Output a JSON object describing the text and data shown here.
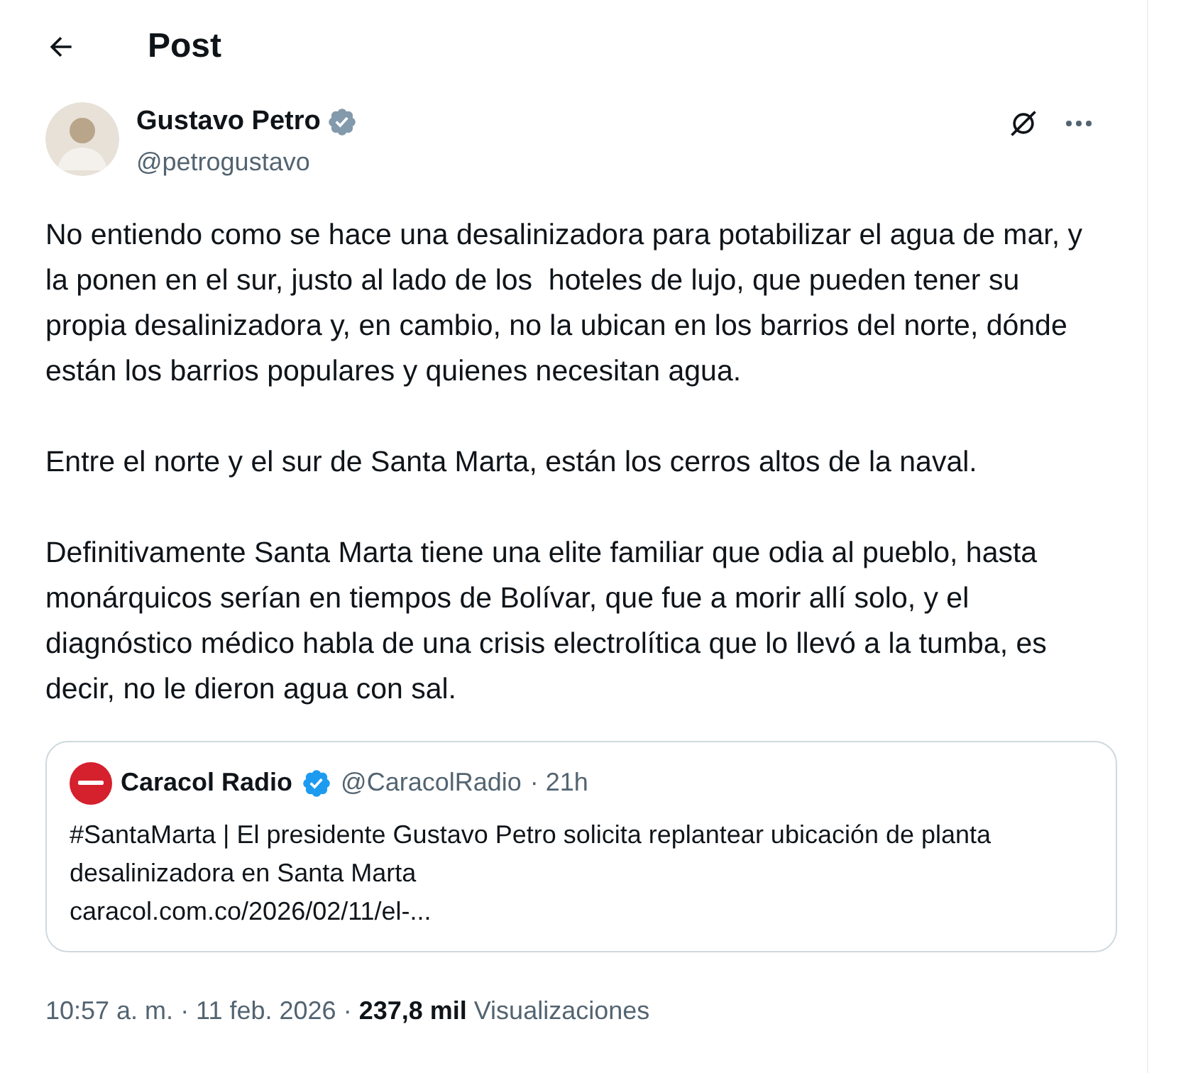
{
  "header": {
    "title": "Post"
  },
  "author": {
    "name": "Gustavo Petro",
    "handle": "@petrogustavo",
    "verified": true
  },
  "paragraphs": [
    "No entiendo como se hace una desalinizadora para potabilizar el agua de mar, y la ponen en el sur, justo al lado de los  hoteles de lujo, que pueden tener su propia desalinizadora y, en cambio, no la ubican en los barrios del norte, dónde están los barrios populares y quienes necesitan agua.",
    "Entre el norte y el sur de Santa Marta, están los cerros altos de la naval.",
    "Definitivamente Santa Marta tiene una elite familiar que odia al pueblo, hasta monárquicos serían en tiempos de Bolívar, que fue a morir allí solo, y el diagnóstico médico habla de una crisis electrolítica que lo llevó a la tumba, es decir, no le dieron agua con sal."
  ],
  "quote": {
    "name": "Caracol Radio",
    "verified": true,
    "handle": "@CaracolRadio",
    "time": "· 21h",
    "text": "#SantaMarta | El presidente Gustavo Petro solicita replantear ubicación de planta desalinizadora en Santa Marta",
    "link": "caracol.com.co/2026/02/11/el-..."
  },
  "meta": {
    "time": "10:57 a. m.",
    "date": "· 11 feb. 2026 ·",
    "views": "237,8 mil",
    "views_label": "Visualizaciones"
  }
}
